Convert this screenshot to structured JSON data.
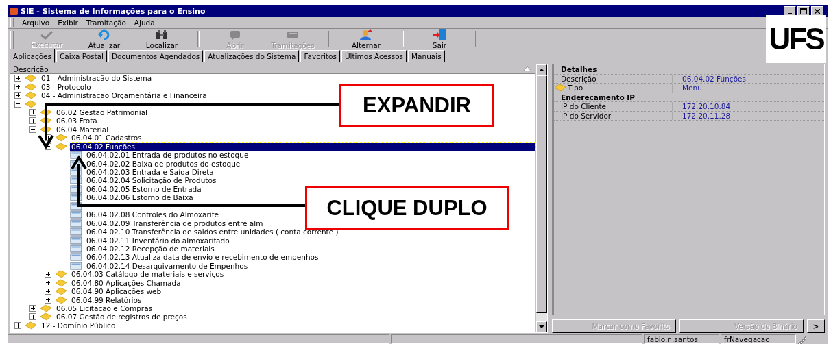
{
  "window": {
    "title": "SIE - Sistema de Informações para o Ensino",
    "logo": "UFS"
  },
  "menu": [
    {
      "label": "Arquivo"
    },
    {
      "label": "Exibir"
    },
    {
      "label": "Tramitação"
    },
    {
      "label": "Ajuda"
    }
  ],
  "toolbar": [
    {
      "label": "Executar",
      "disabled": true,
      "separator_after": false
    },
    {
      "label": "Atualizar",
      "disabled": false,
      "separator_after": false
    },
    {
      "label": "Localizar",
      "disabled": false,
      "separator_after": true
    },
    {
      "label": "Abrir",
      "disabled": true,
      "separator_after": false
    },
    {
      "label": "Tramitações",
      "disabled": true,
      "separator_after": true
    },
    {
      "label": "Alternar",
      "disabled": false,
      "separator_after": true
    },
    {
      "label": "Sair",
      "disabled": false,
      "separator_after": true
    }
  ],
  "tabs": [
    {
      "label": "Aplicações",
      "selected": true
    },
    {
      "label": "Caixa Postal",
      "selected": false
    },
    {
      "label": "Documentos Agendados",
      "selected": false
    },
    {
      "label": "Atualizações do Sistema",
      "selected": false
    },
    {
      "label": "Favoritos",
      "selected": false
    },
    {
      "label": "Últimos Acessos",
      "selected": false
    },
    {
      "label": "Manuais",
      "selected": false
    }
  ],
  "tree": {
    "column": "Descrição",
    "nodes": [
      {
        "kind": "folder",
        "label": "01 - Administração do Sistema",
        "expanded": false,
        "selected": false
      },
      {
        "kind": "folder",
        "label": "03 - Protocolo",
        "expanded": false,
        "selected": false
      },
      {
        "kind": "folder",
        "label": "04 - Administração Orçamentária e Financeira",
        "expanded": false,
        "selected": false
      },
      {
        "kind": "folder",
        "expanded": true,
        "selected": false,
        "children": [
          {
            "kind": "folder",
            "label": "06.02 Gestão Patrimonial",
            "expanded": false,
            "selected": false
          },
          {
            "kind": "folder",
            "label": "06.03 Frota",
            "expanded": false,
            "selected": false
          },
          {
            "kind": "folder",
            "label": "06.04 Material",
            "expanded": true,
            "selected": false,
            "children": [
              {
                "kind": "folder",
                "label": "06.04.01 Cadastros",
                "expanded": false,
                "selected": false
              },
              {
                "kind": "folder",
                "label": "06.04.02 Funções",
                "expanded": true,
                "selected": true,
                "children": [
                  {
                    "kind": "item",
                    "label": "06.04.02.01 Entrada de produtos no estoque",
                    "selected": false
                  },
                  {
                    "kind": "item",
                    "label": "06.04.02.02 Baixa de produtos do estoque",
                    "selected": false
                  },
                  {
                    "kind": "item",
                    "label": "06.04.02.03 Entrada e Saída Direta",
                    "selected": false
                  },
                  {
                    "kind": "item",
                    "label": "06.04.02.04 Solicitação de Produtos",
                    "selected": false
                  },
                  {
                    "kind": "item",
                    "label": "06.04.02.05 Estorno de Entrada",
                    "selected": false
                  },
                  {
                    "kind": "item",
                    "label": "06.04.02.06 Estorno de Baixa",
                    "selected": false
                  },
                  {
                    "kind": "item",
                    "selected": false
                  },
                  {
                    "kind": "item",
                    "label": "06.04.02.08 Controles do Almoxarife",
                    "selected": false
                  },
                  {
                    "kind": "item",
                    "label": "06.04.02.09 Transferência de produtos entre alm",
                    "selected": false
                  },
                  {
                    "kind": "item",
                    "label": "06.04.02.10 Transferência de saldos entre unidades ( conta corrente )",
                    "selected": false
                  },
                  {
                    "kind": "item",
                    "label": "06.04.02.11 Inventário do almoxarifado",
                    "selected": false
                  },
                  {
                    "kind": "item",
                    "label": "06.04.02.12 Recepção de materiais",
                    "selected": false
                  },
                  {
                    "kind": "item",
                    "label": "06.04.02.13 Atualiza data de envio e recebimento de empenhos",
                    "selected": false
                  },
                  {
                    "kind": "item",
                    "label": "06.04.02.14 Desarquivamento de Empenhos",
                    "selected": false
                  }
                ]
              },
              {
                "kind": "folder",
                "label": "06.04.03 Catálogo de materiais e serviços",
                "expanded": false,
                "selected": false
              },
              {
                "kind": "folder",
                "label": "06.04.80 Aplicações Chamada",
                "expanded": false,
                "selected": false
              },
              {
                "kind": "folder",
                "label": "06.04.90 Aplicações web",
                "expanded": false,
                "selected": false
              },
              {
                "kind": "folder",
                "label": "06.04.99 Relatórios",
                "expanded": false,
                "selected": false
              }
            ]
          },
          {
            "kind": "folder",
            "label": "06.05 Licitação e Compras",
            "expanded": false,
            "selected": false
          },
          {
            "kind": "folder",
            "label": "06.07 Gestão de registros de preços",
            "expanded": false,
            "selected": false
          }
        ]
      },
      {
        "kind": "folder",
        "label": "12 - Domínio Público",
        "expanded": false,
        "selected": false
      }
    ]
  },
  "details": [
    {
      "kind": "section",
      "label": "Detalhes"
    },
    {
      "kind": "field",
      "label": "Descrição",
      "value": "06.04.02 Funções"
    },
    {
      "kind": "field",
      "label": "Tipo",
      "icon": true,
      "value": "Menu"
    },
    {
      "kind": "section",
      "label": "Endereçamento IP"
    },
    {
      "kind": "field",
      "label": "IP do Cliente",
      "value": "172.20.10.84"
    },
    {
      "kind": "field",
      "label": "IP do Servidor",
      "value": "172.20.11.28"
    }
  ],
  "buttons": [
    {
      "label": "Marcar como Favorito",
      "disabled": true
    },
    {
      "label": "Versão do Binário",
      "disabled": true
    },
    {
      "label": ">",
      "disabled": false
    }
  ],
  "status_bar": [
    "fabio.n.santos",
    "frNavegacao"
  ],
  "callouts": [
    {
      "label": "EXPANDIR"
    },
    {
      "label": "CLIQUE DUPLO"
    }
  ]
}
